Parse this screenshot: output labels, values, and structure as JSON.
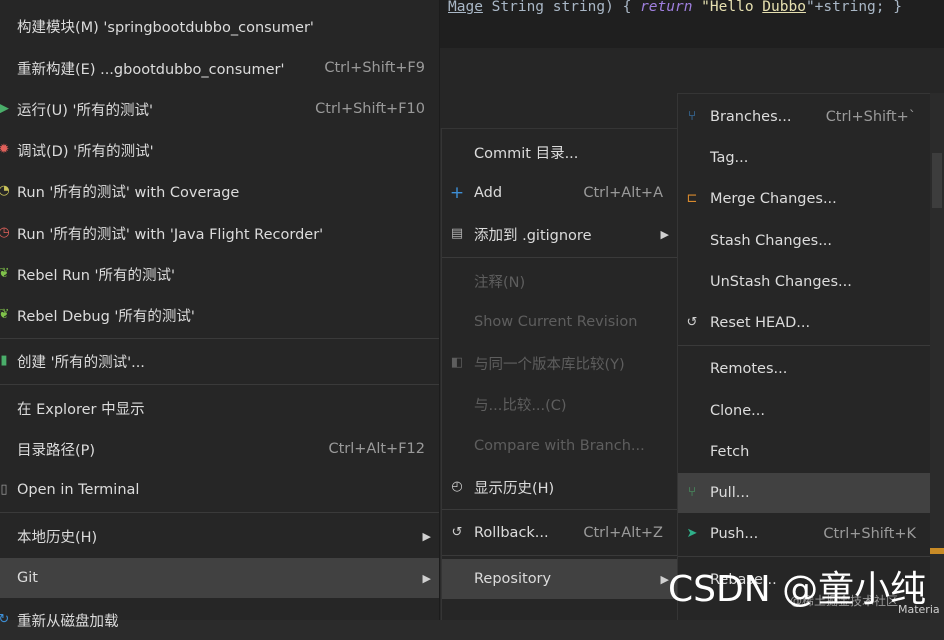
{
  "code": {
    "param_type_prefix": "Mage",
    "text_1": " String string) { ",
    "keyword": "return",
    "str_open": " \"Hello ",
    "str_word": "Dubbo",
    "str_close": "\"+string; }"
  },
  "main_menu": {
    "items": [
      {
        "label": "构建模块(M) 'springbootdubbo_consumer'",
        "shortcut": "",
        "icon": ""
      },
      {
        "label": "重新构建(E) ...gbootdubbo_consumer'",
        "shortcut": "Ctrl+Shift+F9",
        "icon": ""
      },
      {
        "label": "运行(U) '所有的测试'",
        "shortcut": "Ctrl+Shift+F10",
        "icon": "run-icon"
      },
      {
        "label": "调试(D) '所有的测试'",
        "shortcut": "",
        "icon": "debug-icon"
      },
      {
        "label": "Run '所有的测试' with Coverage",
        "shortcut": "",
        "icon": "coverage-icon"
      },
      {
        "label": "Run '所有的测试' with 'Java Flight Recorder'",
        "shortcut": "",
        "icon": "profiler-icon"
      },
      {
        "label": "Rebel Run '所有的测试'",
        "shortcut": "",
        "icon": "jrebel-run-icon"
      },
      {
        "label": "Rebel Debug '所有的测试'",
        "shortcut": "",
        "icon": "jrebel-debug-icon"
      },
      {
        "label": "创建 '所有的测试'...",
        "shortcut": "",
        "icon": "create-config-icon"
      },
      {
        "label": "在 Explorer 中显示",
        "shortcut": "",
        "icon": ""
      },
      {
        "label": "目录路径(P)",
        "shortcut": "Ctrl+Alt+F12",
        "icon": ""
      },
      {
        "label": "Open in Terminal",
        "shortcut": "",
        "icon": ""
      },
      {
        "label": "本地历史(H)",
        "shortcut": "",
        "icon": ""
      },
      {
        "label": "Git",
        "shortcut": "",
        "icon": ""
      },
      {
        "label": "重新从磁盘加载",
        "shortcut": "",
        "icon": "reload-icon"
      }
    ]
  },
  "git_menu": {
    "items": [
      {
        "label": "Commit 目录...",
        "shortcut": "",
        "icon": ""
      },
      {
        "label": "Add",
        "shortcut": "Ctrl+Alt+A",
        "icon": "plus-icon"
      },
      {
        "label": "添加到 .gitignore",
        "shortcut": "",
        "icon": "gitignore-icon"
      },
      {
        "label": "注释(N)",
        "shortcut": "",
        "icon": ""
      },
      {
        "label": "Show Current Revision",
        "shortcut": "",
        "icon": ""
      },
      {
        "label": "与同一个版本库比较(Y)",
        "shortcut": "",
        "icon": "compare-icon"
      },
      {
        "label": "与...比较...(C)",
        "shortcut": "",
        "icon": ""
      },
      {
        "label": "Compare with Branch...",
        "shortcut": "",
        "icon": ""
      },
      {
        "label": "显示历史(H)",
        "shortcut": "",
        "icon": "history-icon"
      },
      {
        "label": "Rollback...",
        "shortcut": "Ctrl+Alt+Z",
        "icon": "rollback-icon"
      },
      {
        "label": "Repository",
        "shortcut": "",
        "icon": ""
      }
    ]
  },
  "repo_menu": {
    "items": [
      {
        "label": "Branches...",
        "shortcut": "Ctrl+Shift+`",
        "icon": "branch-icon"
      },
      {
        "label": "Tag...",
        "shortcut": "",
        "icon": ""
      },
      {
        "label": "Merge Changes...",
        "shortcut": "",
        "icon": "merge-icon"
      },
      {
        "label": "Stash Changes...",
        "shortcut": "",
        "icon": ""
      },
      {
        "label": "UnStash Changes...",
        "shortcut": "",
        "icon": ""
      },
      {
        "label": "Reset HEAD...",
        "shortcut": "",
        "icon": "reset-icon"
      },
      {
        "label": "Remotes...",
        "shortcut": "",
        "icon": ""
      },
      {
        "label": "Clone...",
        "shortcut": "",
        "icon": ""
      },
      {
        "label": "Fetch",
        "shortcut": "",
        "icon": ""
      },
      {
        "label": "Pull...",
        "shortcut": "",
        "icon": "pull-icon"
      },
      {
        "label": "Push...",
        "shortcut": "Ctrl+Shift+K",
        "icon": "push-icon"
      },
      {
        "label": "Rebase...",
        "shortcut": "",
        "icon": ""
      }
    ]
  },
  "watermark": {
    "main": "CSDN @童小纯",
    "small": "@稀土掘金技术社区"
  },
  "corner_label": "Materia",
  "colors": {
    "menu_bg": "#262626",
    "active_bg": "#414141",
    "accent_blue": "#3e8fd6",
    "accent_green": "#4aae6a",
    "accent_orange": "#d88a2e"
  }
}
